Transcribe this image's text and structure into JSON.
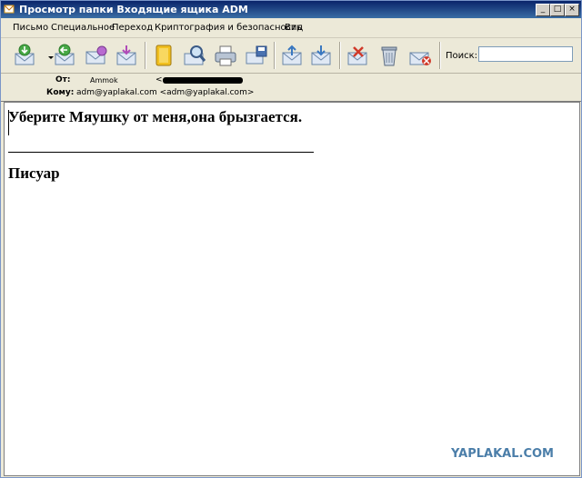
{
  "window": {
    "title": "Просмотр папки Входящие ящика ADM",
    "buttons": [
      "_",
      "□",
      "×"
    ]
  },
  "menubar": {
    "items": [
      {
        "label": "Письмо"
      },
      {
        "label": "Специальное"
      },
      {
        "label": "Переход"
      },
      {
        "label": "Криптография и безопасность"
      },
      {
        "label": "Вид"
      }
    ]
  },
  "toolbar": {
    "search_label": "Поиск:",
    "search_value": "",
    "icons": [
      "get-mail-icon",
      "reply-icon",
      "forward-icon",
      "send-icon",
      "address-book-icon",
      "find-icon",
      "print-icon",
      "save-icon",
      "move-up-icon",
      "move-down-icon",
      "delete-icon",
      "trash-icon",
      "junk-icon"
    ]
  },
  "headers": {
    "from_label": "От:",
    "from_name": "Ammok",
    "from_email_open": "<",
    "to_label": "Кому:",
    "to_value": "adm@yaplakal.com <adm@yaplakal.com>"
  },
  "message": {
    "line1": "Уберите Мяушку от меня,она брызгается.",
    "signature": "Писуар"
  },
  "watermark": "YAPLAKAL.COM",
  "colors": {
    "titlebar": "#0a246a",
    "chrome": "#ece9d8",
    "watermark": "#4b7ea9"
  }
}
